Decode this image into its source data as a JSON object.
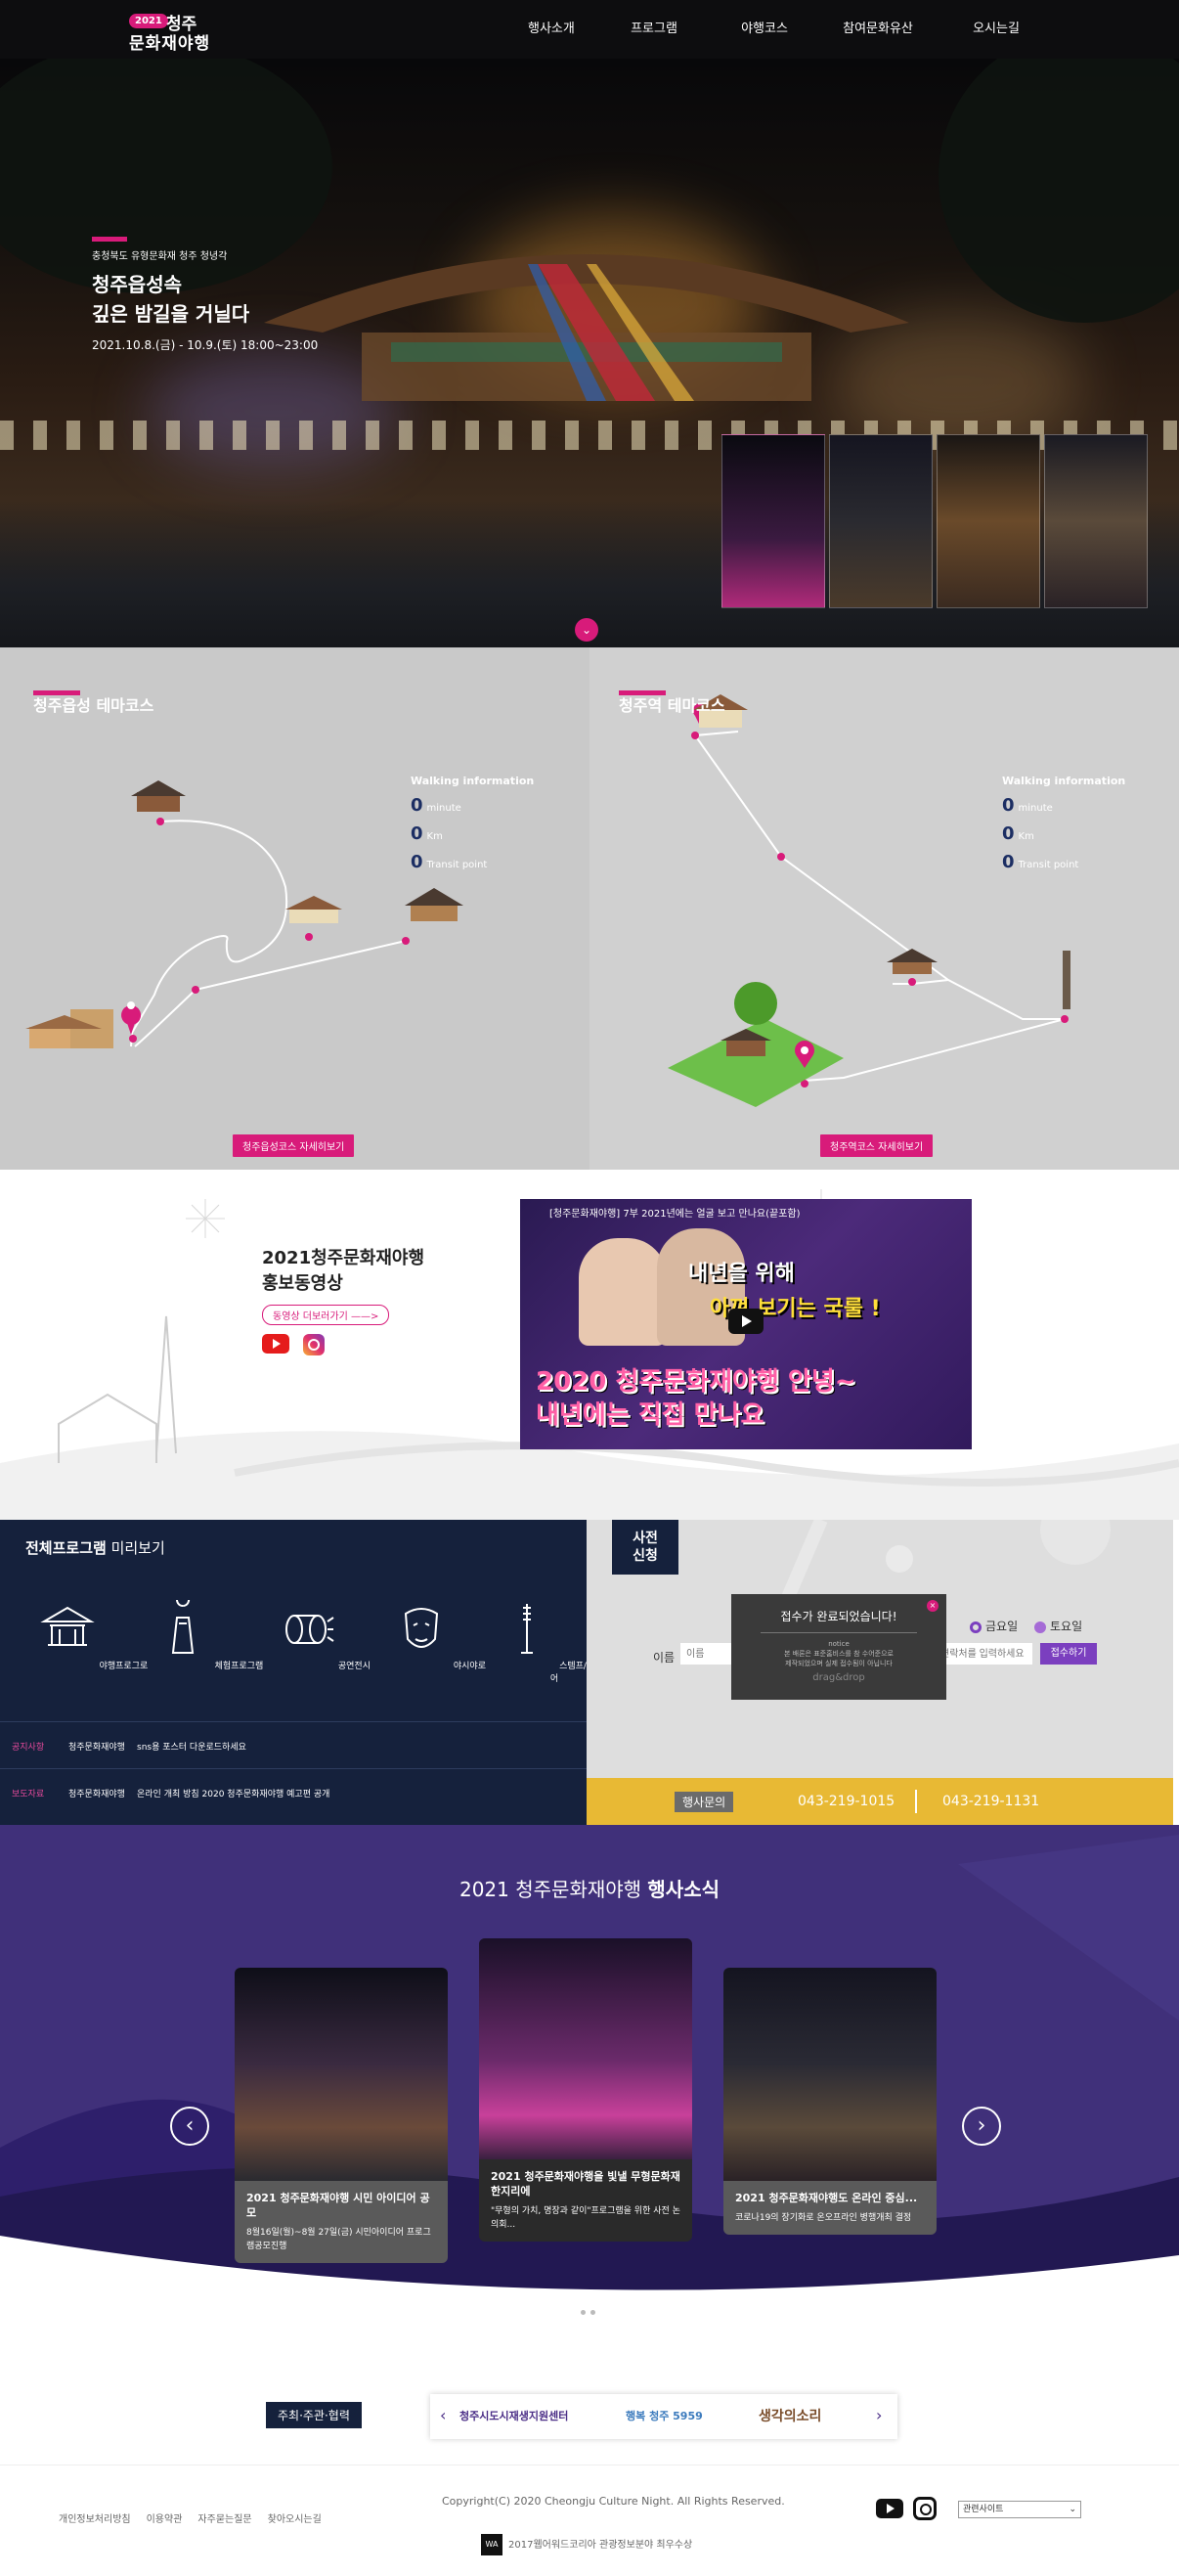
{
  "header": {
    "logo_year": "2021",
    "logo_line1": "청주",
    "logo_line2": "문화재야행",
    "nav": [
      "행사소개",
      "프로그램",
      "야행코스",
      "참여문화유산",
      "오시는길"
    ]
  },
  "hero": {
    "subtitle": "충청북도 유형문화재 청주 청녕각",
    "title_line1": "청주읍성속",
    "title_line2": "깊은 밤길을 거닐다",
    "date": "2021.10.8.(금) - 10.9.(토) 18:00~23:00"
  },
  "courses": [
    {
      "title": "청주읍성 테마코스",
      "walking_title": "Walking information",
      "minute": "0",
      "minute_unit": "minute",
      "km": "0",
      "km_unit": "Km",
      "transit": "0",
      "transit_unit": "Transit point",
      "button": "청주읍성코스 자세히보기"
    },
    {
      "title": "청주역 테마코스",
      "walking_title": "Walking information",
      "minute": "0",
      "minute_unit": "minute",
      "km": "0",
      "km_unit": "Km",
      "transit": "0",
      "transit_unit": "Transit point",
      "button": "청주역코스 자세히보기"
    }
  ],
  "promo": {
    "title_line1": "2021청주문화재야행",
    "title_line2": "홍보동영상",
    "more_button": "동영상 더보러가기 ——>",
    "video": {
      "top_title": "[청주문화재야행] 7부 2021년에는 얼굴 보고 만나요(끝포함)",
      "text1": "내년을 위해",
      "text2": "아껴 보기는 국룰 !",
      "text3_line1": "2020 청주문화재야행 안녕~",
      "text3_line2": "내년에는 직접 만나요"
    }
  },
  "program": {
    "title_bold": "전체프로그램",
    "title_rest": " 미리보기",
    "items": [
      "야행프로그로",
      "체험프로그램",
      "공연전시",
      "야시야로",
      "스템프/미션투어"
    ],
    "notices": [
      {
        "label": "공지사항",
        "source": "청주문화재야행",
        "text": "sns용 포스터 다운로드하세요"
      },
      {
        "label": "보도자료",
        "source": "청주문화재야행",
        "text": "온라인 개최 방침 2020 청주문화재야행 예고편 공개"
      }
    ]
  },
  "apply": {
    "badge_line1": "사전",
    "badge_line2": "신청",
    "radio_fri": "금요일",
    "radio_sat": "토요일",
    "name_label": "이름",
    "name_placeholder": "이름",
    "tel_placeholder": "연락처를 입력하세요",
    "submit": "접수하기",
    "popup_title": "접수가 완료되었습니다!",
    "popup_notice": "notice",
    "popup_text1": "본 배론은 표준홈비스를 참 수어준으로",
    "popup_text2": "제작되었으며 실제 접수됨이 아닙니다",
    "popup_drag": "drag&drop",
    "popup_close": "×"
  },
  "contact": {
    "label": "행사문의",
    "phone1": "043-219-1015",
    "phone2": "043-219-1131"
  },
  "news": {
    "title_plain": "2021 청주문화재야행 ",
    "title_bold": "행사소식",
    "cards": [
      {
        "title": "2021 청주문화재야행 시민 아이디어 공모",
        "desc": "8월16일(월)~8월 27일(금) 시민아이디어 프로그램공모진행"
      },
      {
        "title": "2021 청주문화재야행을 빛낼 무형문화재 한지리에",
        "desc": "\"무형의 가치, 명장과 같이\"프로그램을 위한 사전 논의회..."
      },
      {
        "title": "2021 청주문화재야행도 온라인 중심...",
        "desc": "코로나19의 장기화로 온오프라인 병행개최 결정"
      }
    ],
    "prev": "‹",
    "next": "›"
  },
  "sponsors": {
    "label": "주최·주관·협력",
    "s1": "청주시도시재생지원센터",
    "s2": "행복 청주 5959",
    "s3": "생각의소리"
  },
  "footer": {
    "links": [
      "개인정보처리방침",
      "이용약관",
      "자주묻는질문",
      "찾아오시는길"
    ],
    "copyright": "Copyright(C) 2020 Cheongju Culture Night. All Rights Reserved.",
    "award_badge": "WA",
    "award": "2017웹어워드코리아 관광정보분야 최우수상",
    "related_sites": "관련사이트"
  },
  "colors": {
    "accent": "#d81b7a",
    "navy": "#15213c",
    "purple": "#40307a",
    "yellow": "#e8b934"
  }
}
